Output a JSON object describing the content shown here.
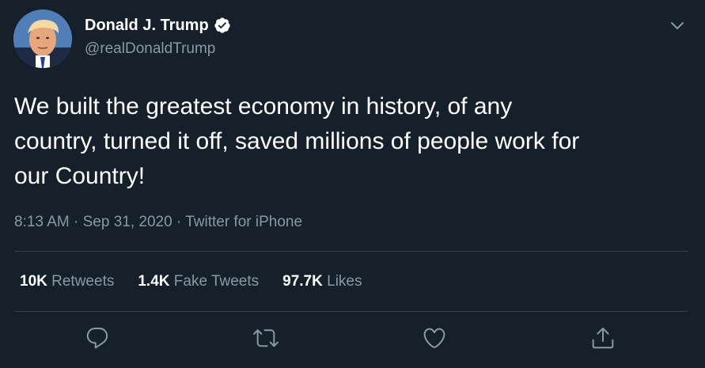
{
  "user": {
    "display_name": "Donald J. Trump",
    "handle": "@realDonaldTrump",
    "verified": true
  },
  "tweet": {
    "text": "We built the greatest economy in history, of any\ncountry, turned it off, saved millions of people work for\nour Country!",
    "time": "8:13 AM",
    "date": "Sep 31, 2020",
    "source": "Twitter for iPhone",
    "separator": "·"
  },
  "stats": {
    "retweets_count": "10K",
    "retweets_label": "Retweets",
    "fake_count": "1.4K",
    "fake_label": "Fake Tweets",
    "likes_count": "97.7K",
    "likes_label": "Likes"
  },
  "icons": {
    "menu": "chevron-down-icon",
    "reply": "reply-icon",
    "retweet": "retweet-icon",
    "like": "heart-icon",
    "share": "share-icon",
    "verified": "verified-badge-icon"
  },
  "colors": {
    "background": "#15202b",
    "text_primary": "#ffffff",
    "text_secondary": "#8899a6",
    "divider": "#38444d"
  }
}
